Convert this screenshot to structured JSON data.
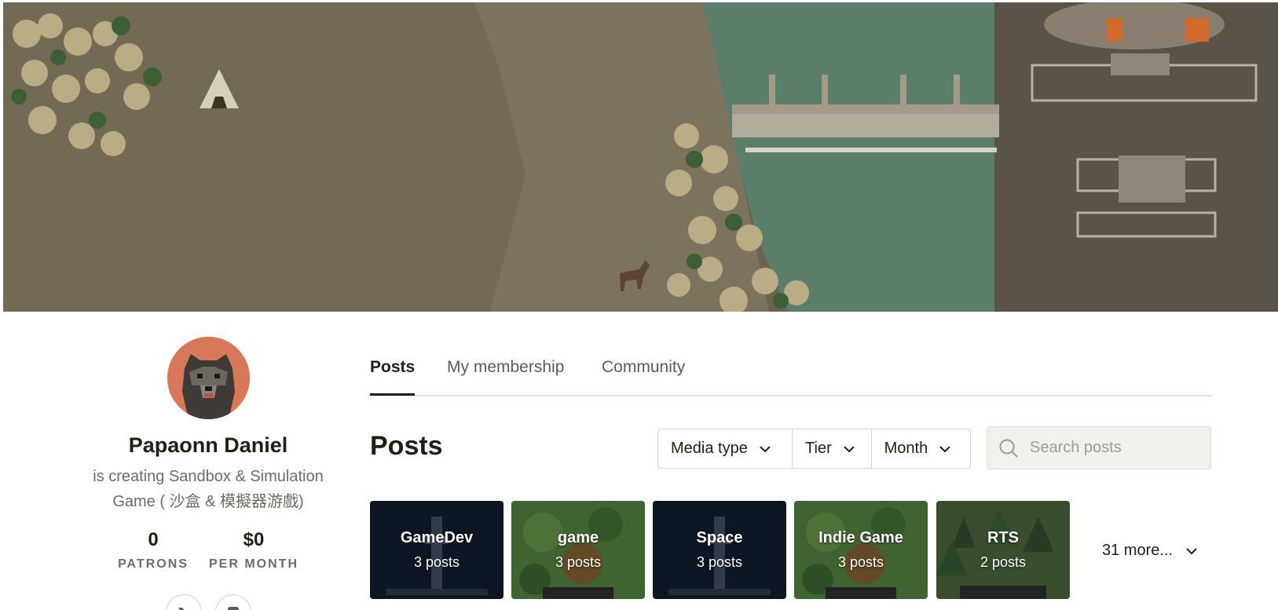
{
  "creator": {
    "name": "Papaonn Daniel",
    "tagline": "is creating Sandbox & Simulation Game ( 沙盒 & 模擬器游戲)",
    "stats": [
      {
        "value": "0",
        "label": "PATRONS"
      },
      {
        "value": "$0",
        "label": "PER MONTH"
      }
    ]
  },
  "tabs": [
    {
      "label": "Posts",
      "active": true
    },
    {
      "label": "My membership",
      "active": false
    },
    {
      "label": "Community",
      "active": false
    }
  ],
  "posts": {
    "heading": "Posts",
    "filters": [
      "Media type",
      "Tier",
      "Month"
    ],
    "search_placeholder": "Search posts",
    "tags": [
      {
        "name": "GameDev",
        "count": "3 posts",
        "theme": "space"
      },
      {
        "name": "game",
        "count": "3 posts",
        "theme": "forest"
      },
      {
        "name": "Space",
        "count": "3 posts",
        "theme": "space"
      },
      {
        "name": "Indie Game",
        "count": "3 posts",
        "theme": "forest"
      },
      {
        "name": "RTS",
        "count": "2 posts",
        "theme": "trees"
      }
    ],
    "more_label": "31 more..."
  },
  "colors": {
    "text_primary": "#241e12",
    "text_secondary": "#706c64",
    "avatar_bg": "#d9775a",
    "river": "#5a7e69"
  }
}
